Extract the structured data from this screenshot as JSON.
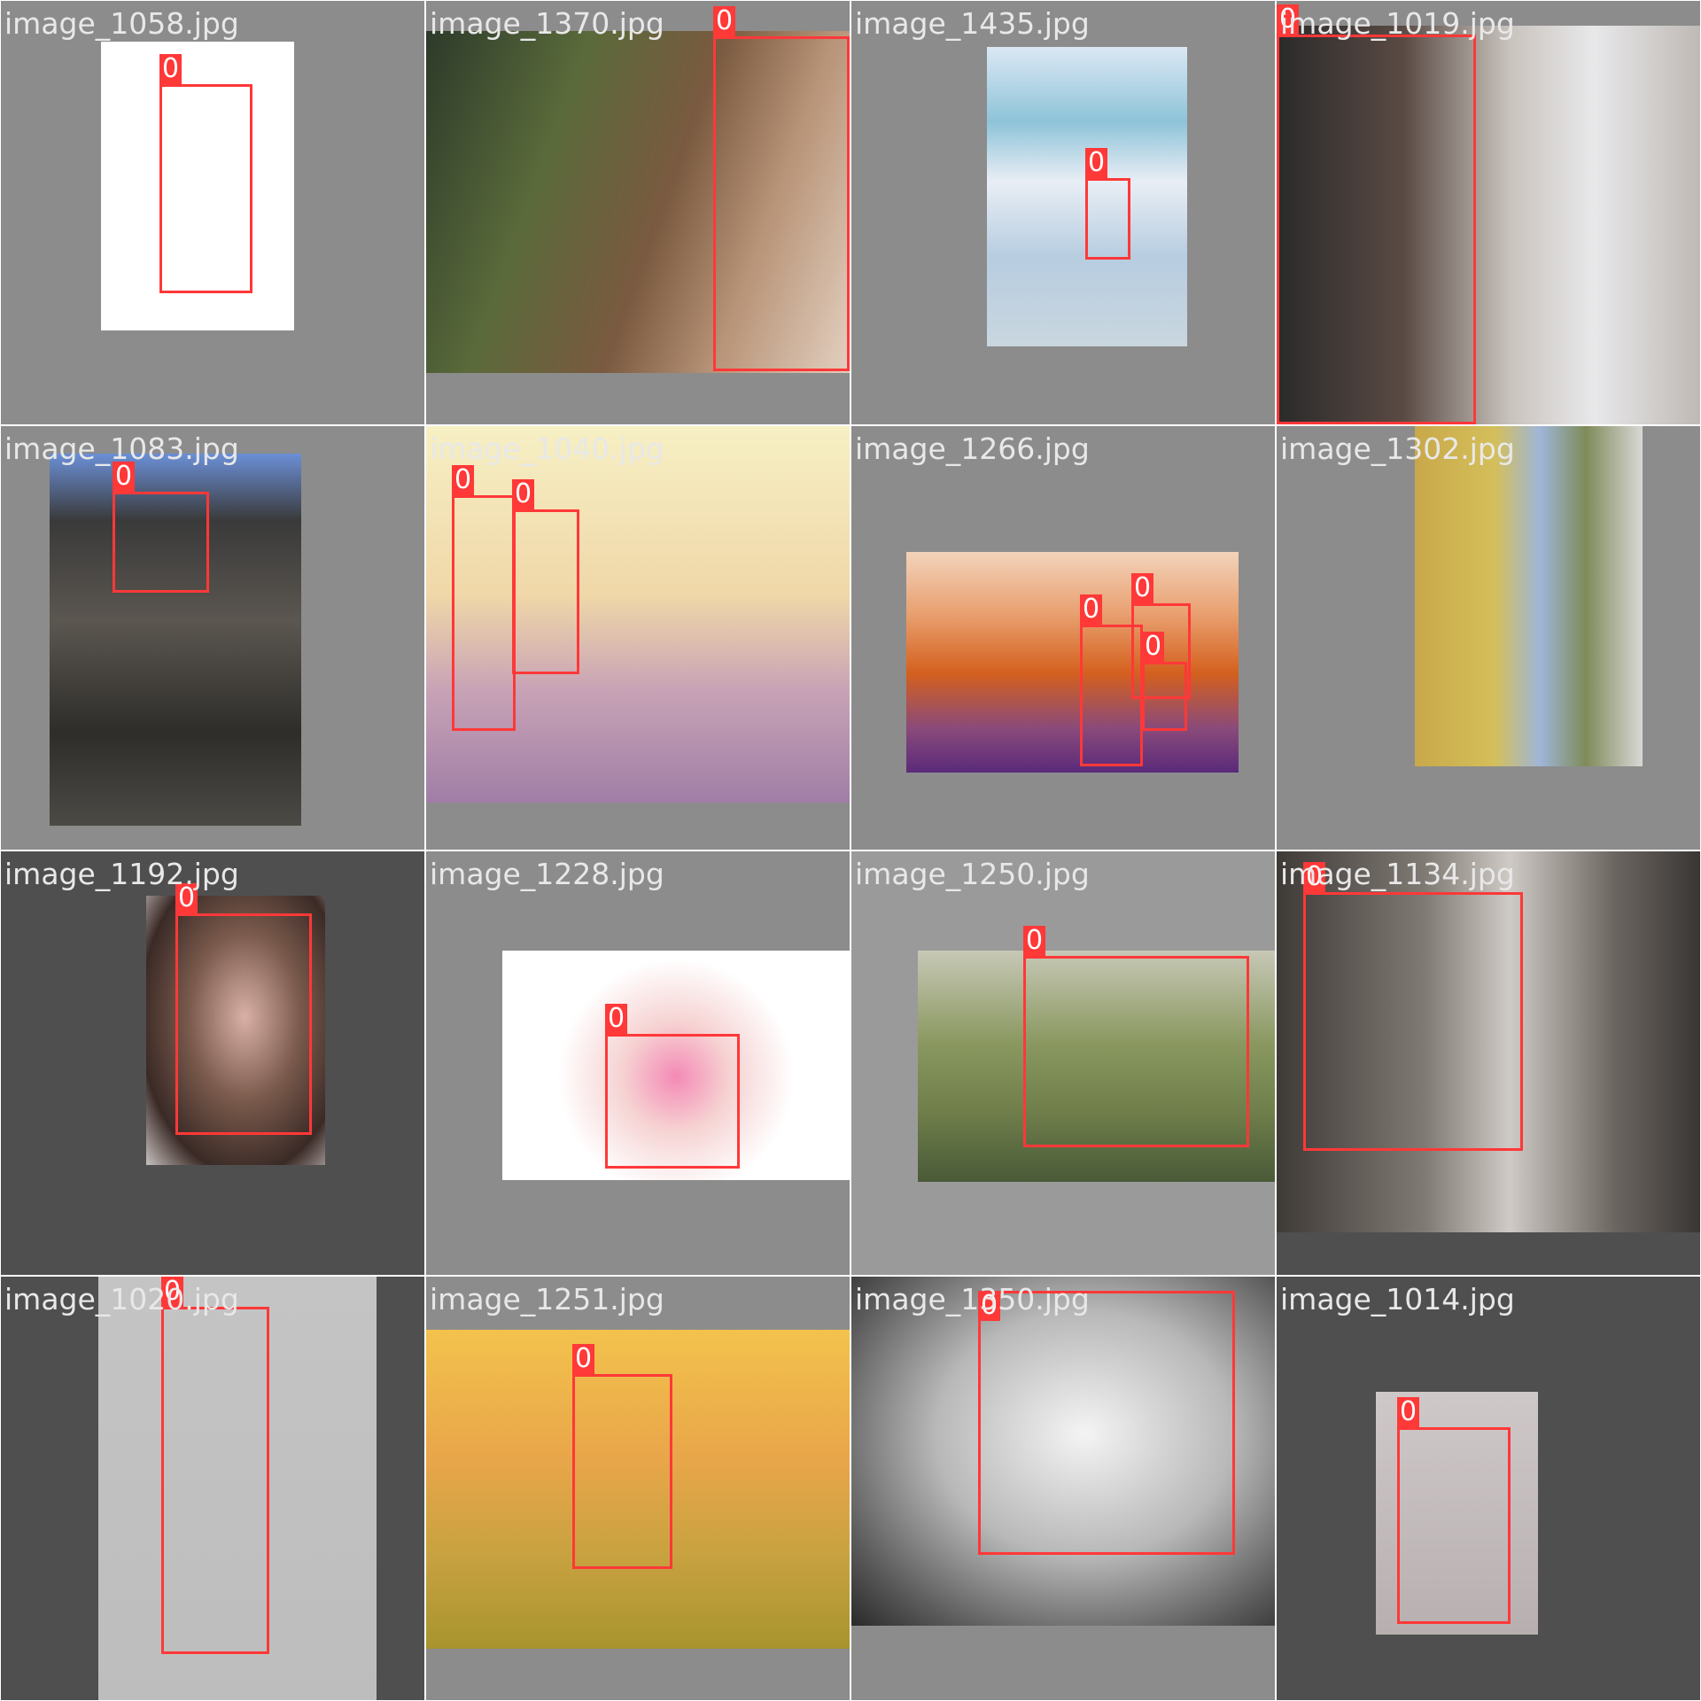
{
  "mosaic": {
    "bg_colors": {
      "gray": "#8c8c8c",
      "dark": "#4f4f4f",
      "light": "#9a9a9a"
    },
    "box_color": "#ff3838",
    "tiles": [
      {
        "filename": "image_1058.jpg",
        "boxes": [
          {
            "label": "0"
          }
        ]
      },
      {
        "filename": "image_1370.jpg",
        "boxes": [
          {
            "label": "0"
          }
        ]
      },
      {
        "filename": "image_1435.jpg",
        "boxes": [
          {
            "label": "0"
          }
        ]
      },
      {
        "filename": "image_1019.jpg",
        "boxes": [
          {
            "label": "0"
          }
        ]
      },
      {
        "filename": "image_1083.jpg",
        "boxes": [
          {
            "label": "0"
          }
        ]
      },
      {
        "filename": "image_1040.jpg",
        "boxes": [
          {
            "label": "0"
          },
          {
            "label": "0"
          }
        ]
      },
      {
        "filename": "image_1266.jpg",
        "boxes": [
          {
            "label": "0"
          },
          {
            "label": "0"
          },
          {
            "label": "0"
          }
        ]
      },
      {
        "filename": "image_1302.jpg",
        "boxes": []
      },
      {
        "filename": "image_1192.jpg",
        "boxes": [
          {
            "label": "0"
          }
        ]
      },
      {
        "filename": "image_1228.jpg",
        "boxes": [
          {
            "label": "0"
          }
        ]
      },
      {
        "filename": "image_1250.jpg",
        "boxes": [
          {
            "label": "0"
          }
        ]
      },
      {
        "filename": "image_1134.jpg",
        "boxes": [
          {
            "label": "0"
          }
        ]
      },
      {
        "filename": "image_1020.jpg",
        "boxes": [
          {
            "label": "0"
          }
        ]
      },
      {
        "filename": "image_1251.jpg",
        "boxes": [
          {
            "label": "0"
          }
        ]
      },
      {
        "filename": "image_1350.jpg",
        "boxes": [
          {
            "label": "0"
          }
        ]
      },
      {
        "filename": "image_1014.jpg",
        "boxes": [
          {
            "label": "0"
          }
        ]
      }
    ]
  }
}
